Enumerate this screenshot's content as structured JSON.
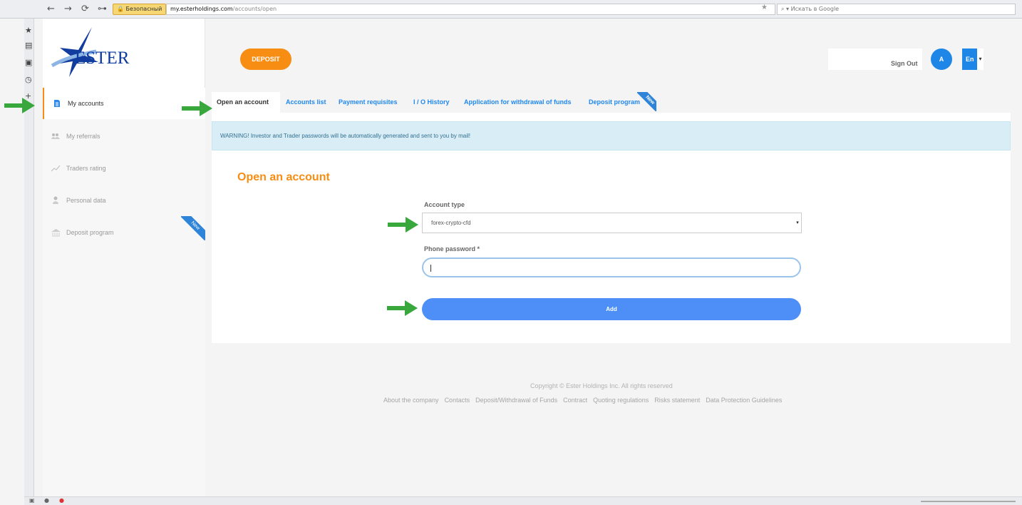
{
  "browser": {
    "security_label": "Безопасный",
    "url_host": "my.esterholdings.com",
    "url_path": "/accounts/open",
    "search_placeholder": "Искать в Google"
  },
  "brand": {
    "logo_text": "ESTER"
  },
  "header": {
    "deposit_label": "DEPOSIT",
    "signout_label": "Sign Out",
    "avatar_letter": "A",
    "language": "En"
  },
  "sidebar": {
    "items": [
      {
        "label": "My accounts"
      },
      {
        "label": "My referrals"
      },
      {
        "label": "Traders rating"
      },
      {
        "label": "Personal data"
      },
      {
        "label": "Deposit program",
        "ribbon": "New"
      }
    ]
  },
  "tabs": [
    {
      "label": "Open an account"
    },
    {
      "label": "Accounts list"
    },
    {
      "label": "Payment requisites"
    },
    {
      "label": "I / O History"
    },
    {
      "label": "Application for withdrawal of funds"
    },
    {
      "label": "Deposit program",
      "ribbon": "New"
    }
  ],
  "main": {
    "warning": "WARNING! Investor and Trader passwords will be automatically generated and sent to you by mail!",
    "title": "Open an account",
    "account_type_label": "Account type",
    "account_type_value": "forex-crypto-cfd",
    "phone_password_label": "Phone password *",
    "phone_password_value": "",
    "submit_label": "Add"
  },
  "footer": {
    "copyright": "Copyright © Ester Holdings Inc. All rights reserved",
    "links": [
      "About the company",
      "Contacts",
      "Deposit/Withdrawal of Funds",
      "Contract",
      "Quoting regulations",
      "Risks statement",
      "Data Protection Guidelines"
    ]
  },
  "colors": {
    "accent_orange": "#f78d12",
    "accent_blue": "#1f88ef",
    "button_blue": "#4d8ff7",
    "annotation_green": "#39a83c"
  },
  "icons": {
    "annotation_arrow": "green-right-arrow-icon"
  }
}
